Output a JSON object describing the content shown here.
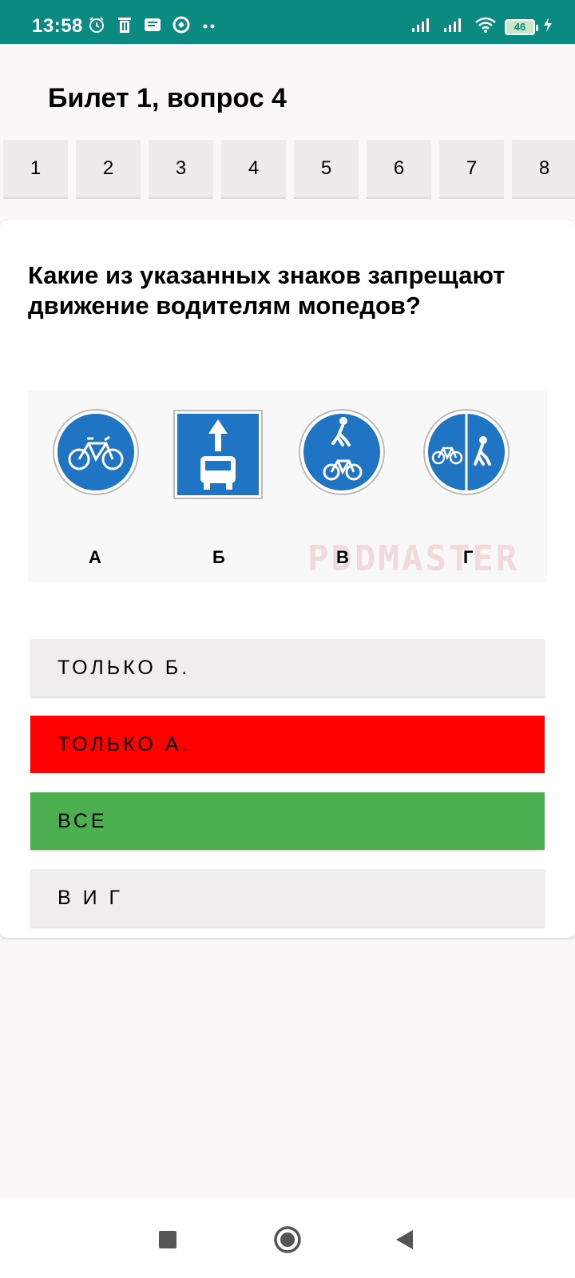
{
  "status_bar": {
    "time": "13:58",
    "battery": "46",
    "icons_left": [
      "alarm-icon",
      "trash-icon",
      "message-icon",
      "vpn-icon",
      "more-dots-icon"
    ],
    "icons_right": [
      "signal-icon",
      "signal-icon",
      "wifi-icon",
      "battery-icon",
      "charging-icon"
    ]
  },
  "header": {
    "title": "Билет 1, вопрос 4"
  },
  "question_tabs": [
    "1",
    "2",
    "3",
    "4",
    "5",
    "6",
    "7",
    "8"
  ],
  "question": {
    "text": "Какие из указанных знаков запрещают движение водителям мопедов?",
    "image": {
      "labels": [
        "А",
        "Б",
        "В",
        "Г"
      ],
      "watermark": "PDDMASTER",
      "sign_color": "#1f74c4"
    }
  },
  "answers": [
    {
      "label": "ТОЛЬКО Б.",
      "state": "neutral"
    },
    {
      "label": "ТОЛЬКО А.",
      "state": "wrong"
    },
    {
      "label": "ВСЕ",
      "state": "correct"
    },
    {
      "label": "В И Г",
      "state": "neutral"
    }
  ],
  "colors": {
    "status_bar": "#0a8a80",
    "wrong": "#ff0000",
    "correct": "#4caf50",
    "neutral": "#f0eeed"
  },
  "nav": [
    "recent-apps-icon",
    "home-icon",
    "back-icon"
  ]
}
